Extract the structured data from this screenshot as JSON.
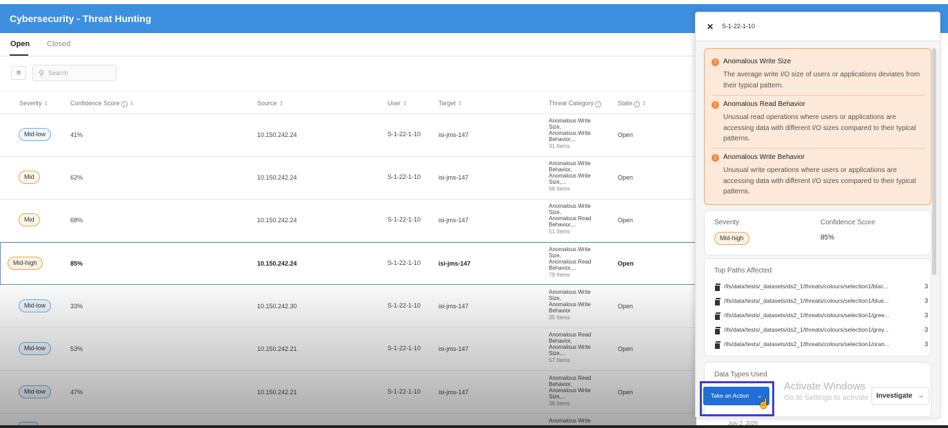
{
  "app": {
    "title": "Cybersecurity - Threat Hunting"
  },
  "tabs": [
    {
      "label": "Open"
    },
    {
      "label": "Closed"
    }
  ],
  "toolbar": {
    "filter_icon": "filter-icon",
    "search_placeholder": "Search"
  },
  "table": {
    "columns": [
      "Severity",
      "Confidence Score",
      "Source",
      "User",
      "Target",
      "Threat Category",
      "State"
    ],
    "rows": [
      {
        "severity": "Mid-low",
        "confidence": "41%",
        "source": "10.150.242.24",
        "user": "S-1-22-1-10",
        "target": "isi-jms-147",
        "category": [
          "Anomalous Write",
          "Size,",
          "Anomalous Write",
          "Behavior,..."
        ],
        "count": "31 Items",
        "state": "Open"
      },
      {
        "severity": "Mid",
        "confidence": "62%",
        "source": "10.150.242.24",
        "user": "S-1-22-1-10",
        "target": "isi-jms-147",
        "category": [
          "Anomalous Write",
          "Behavior,",
          "Anomalous Write",
          "Size,..."
        ],
        "count": "68 Items",
        "state": "Open"
      },
      {
        "severity": "Mid",
        "confidence": "68%",
        "source": "10.150.242.24",
        "user": "S-1-22-1-10",
        "target": "isi-jms-147",
        "category": [
          "Anomalous Write",
          "Size,",
          "Anomalous Read",
          "Behavior,..."
        ],
        "count": "51 Items",
        "state": "Open"
      },
      {
        "severity": "Mid-high",
        "confidence": "85%",
        "source": "10.150.242.24",
        "user": "S-1-22-1-10",
        "target": "isi-jms-147",
        "category": [
          "Anomalous Write",
          "Size,",
          "Anomalous Read",
          "Behavior,..."
        ],
        "count": "79 Items",
        "state": "Open"
      },
      {
        "severity": "Mid-low",
        "confidence": "33%",
        "source": "10.150.242.30",
        "user": "S-1-22-1-10",
        "target": "isi-jms-147",
        "category": [
          "Anomalous Write",
          "Size,",
          "Anomalous Write",
          "Behavior"
        ],
        "count": "35 Items",
        "state": "Open"
      },
      {
        "severity": "Mid-low",
        "confidence": "53%",
        "source": "10.150.242.21",
        "user": "S-1-22-1-10",
        "target": "isi-jms-147",
        "category": [
          "Anomalous Read",
          "Behavior,",
          "Anomalous Write",
          "Size,..."
        ],
        "count": "57 Items",
        "state": "Open"
      },
      {
        "severity": "Mid-low",
        "confidence": "47%",
        "source": "10.150.242.21",
        "user": "S-1-22-1-10",
        "target": "isi-jms-147",
        "category": [
          "Anomalous Read",
          "Behavior,",
          "Anomalous Write",
          "Size,..."
        ],
        "count": "38 Items",
        "state": "Open"
      }
    ],
    "partial_row_category": "Anomalous Write"
  },
  "panel": {
    "title": "S-1-22-1-10",
    "alerts": [
      {
        "title": "Anomalous Write Size",
        "desc": "The average write I/O size of users or applications deviates from their typical pattern."
      },
      {
        "title": "Anomalous Read Behavior",
        "desc": "Unusual read operations where users or applications are accessing data with different I/O sizes compared to their typical patterns."
      },
      {
        "title": "Anomalous Write Behavior",
        "desc": "Unusual write operations where users or applications are accessing data with different I/O sizes compared to their typical patterns."
      }
    ],
    "severity_label": "Severity",
    "severity_value": "Mid-high",
    "confidence_label": "Confidence Score",
    "confidence_value": "85%",
    "paths_title": "Top Paths Affected",
    "paths": [
      {
        "path": "/ifs/data/tests/_datasets/ds2_1/threats/colours/selection1/blac...",
        "count": "3"
      },
      {
        "path": "/ifs/data/tests/_datasets/ds2_1/threats/colours/selection1/blue...",
        "count": "3"
      },
      {
        "path": "/ifs/data/tests/_datasets/ds2_1/threats/colours/selection1/gree...",
        "count": "3"
      },
      {
        "path": "/ifs/data/tests/_datasets/ds2_1/threats/colours/selection1/grey...",
        "count": "3"
      },
      {
        "path": "/ifs/data/tests/_datasets/ds2_1/threats/colours/selection1/oran...",
        "count": "3"
      }
    ],
    "data_types_title": "Data Types Used",
    "action_label": "Take an Action",
    "investigate_label": "Investigate",
    "peek_date": "July 2, 2025"
  },
  "watermark": {
    "line1": "Activate Windows",
    "line2": "Go to Settings to activate Windows."
  },
  "colors": {
    "header": "#3d8fe0",
    "primary_button": "#1f6fd6",
    "alert_bg": "#fde9d9",
    "alert_border": "#f2a66b"
  }
}
